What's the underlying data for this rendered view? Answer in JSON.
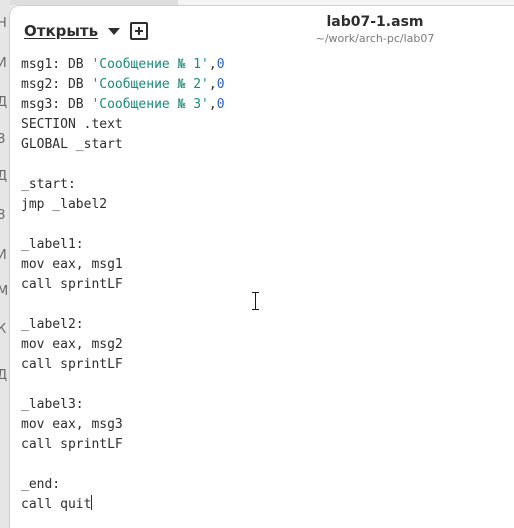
{
  "background_window": {
    "letters": [
      "Н",
      "И",
      "Д",
      "З",
      "Д",
      "З",
      "И",
      "М",
      "К",
      "Д"
    ]
  },
  "header": {
    "open_label": "Открыть",
    "new_tab_icon": "plus-square-icon",
    "title": "lab07-1.asm",
    "subtitle": "~/work/arch-pc/lab07"
  },
  "editor": {
    "lines": [
      "msg1: DB 'Сообщение № 1',0",
      "msg2: DB 'Сообщение № 2',0",
      "msg3: DB 'Сообщение № 3',0",
      "SECTION .text",
      "GLOBAL _start",
      "",
      "_start:",
      "jmp _label2",
      "",
      "_label1:",
      "mov eax, msg1",
      "call sprintLF",
      "",
      "_label2:",
      "mov eax, msg2",
      "call sprintLF",
      "",
      "_label3:",
      "mov eax, msg3",
      "call sprintLF",
      "",
      "_end:",
      "call quit"
    ],
    "colors": {
      "string": "#1a8a7a",
      "number": "#2a60c8",
      "text": "#2e2e2e"
    }
  }
}
